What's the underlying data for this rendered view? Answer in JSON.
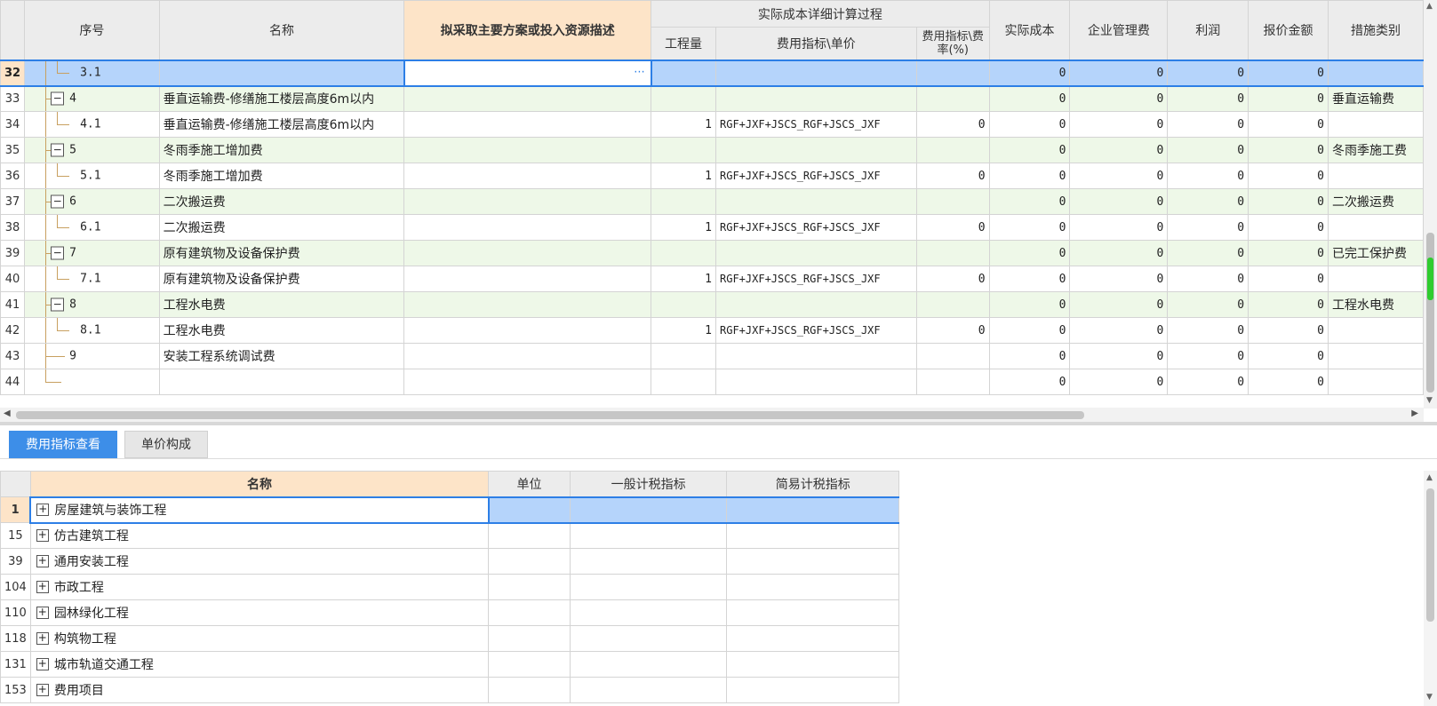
{
  "upper_grid": {
    "headers": {
      "seq": "序号",
      "name": "名称",
      "plan": "拟采取主要方案或投入资源描述",
      "detail_group": "实际成本详细计算过程",
      "qty": "工程量",
      "index_unit": "费用指标\\单价",
      "rate": "费用指标\\费率(%)",
      "actual_cost": "实际成本",
      "mgmt_fee": "企业管理费",
      "profit": "利润",
      "quote": "报价金额",
      "category": "措施类别"
    },
    "rows": [
      {
        "rn": "32",
        "seq": "3.1",
        "level": 2,
        "name": "",
        "qty": "",
        "formula": "",
        "rate": "",
        "actual": "0",
        "mgmt": "0",
        "profit": "0",
        "quote": "0",
        "cat": "",
        "selected": true
      },
      {
        "rn": "33",
        "seq": "4",
        "level": 1,
        "name": "垂直运输费-修缮施工楼层高度6m以内",
        "qty": "",
        "formula": "",
        "rate": "",
        "actual": "0",
        "mgmt": "0",
        "profit": "0",
        "quote": "0",
        "cat": "垂直运输费"
      },
      {
        "rn": "34",
        "seq": "4.1",
        "level": 2,
        "name": "垂直运输费-修缮施工楼层高度6m以内",
        "qty": "1",
        "formula": "RGF+JXF+JSCS_RGF+JSCS_JXF",
        "rate": "0",
        "actual": "0",
        "mgmt": "0",
        "profit": "0",
        "quote": "0",
        "cat": ""
      },
      {
        "rn": "35",
        "seq": "5",
        "level": 1,
        "name": "冬雨季施工增加费",
        "qty": "",
        "formula": "",
        "rate": "",
        "actual": "0",
        "mgmt": "0",
        "profit": "0",
        "quote": "0",
        "cat": "冬雨季施工费"
      },
      {
        "rn": "36",
        "seq": "5.1",
        "level": 2,
        "name": "冬雨季施工增加费",
        "qty": "1",
        "formula": "RGF+JXF+JSCS_RGF+JSCS_JXF",
        "rate": "0",
        "actual": "0",
        "mgmt": "0",
        "profit": "0",
        "quote": "0",
        "cat": ""
      },
      {
        "rn": "37",
        "seq": "6",
        "level": 1,
        "name": "二次搬运费",
        "qty": "",
        "formula": "",
        "rate": "",
        "actual": "0",
        "mgmt": "0",
        "profit": "0",
        "quote": "0",
        "cat": "二次搬运费"
      },
      {
        "rn": "38",
        "seq": "6.1",
        "level": 2,
        "name": "二次搬运费",
        "qty": "1",
        "formula": "RGF+JXF+JSCS_RGF+JSCS_JXF",
        "rate": "0",
        "actual": "0",
        "mgmt": "0",
        "profit": "0",
        "quote": "0",
        "cat": ""
      },
      {
        "rn": "39",
        "seq": "7",
        "level": 1,
        "name": "原有建筑物及设备保护费",
        "qty": "",
        "formula": "",
        "rate": "",
        "actual": "0",
        "mgmt": "0",
        "profit": "0",
        "quote": "0",
        "cat": "已完工保护费"
      },
      {
        "rn": "40",
        "seq": "7.1",
        "level": 2,
        "name": "原有建筑物及设备保护费",
        "qty": "1",
        "formula": "RGF+JXF+JSCS_RGF+JSCS_JXF",
        "rate": "0",
        "actual": "0",
        "mgmt": "0",
        "profit": "0",
        "quote": "0",
        "cat": ""
      },
      {
        "rn": "41",
        "seq": "8",
        "level": 1,
        "name": "工程水电费",
        "qty": "",
        "formula": "",
        "rate": "",
        "actual": "0",
        "mgmt": "0",
        "profit": "0",
        "quote": "0",
        "cat": "工程水电费"
      },
      {
        "rn": "42",
        "seq": "8.1",
        "level": 2,
        "name": "工程水电费",
        "qty": "1",
        "formula": "RGF+JXF+JSCS_RGF+JSCS_JXF",
        "rate": "0",
        "actual": "0",
        "mgmt": "0",
        "profit": "0",
        "quote": "0",
        "cat": ""
      },
      {
        "rn": "43",
        "seq": "9",
        "level": 0,
        "name": "安装工程系统调试费",
        "qty": "",
        "formula": "",
        "rate": "",
        "actual": "0",
        "mgmt": "0",
        "profit": "0",
        "quote": "0",
        "cat": ""
      },
      {
        "rn": "44",
        "seq": "",
        "level": 0,
        "name": "",
        "qty": "",
        "formula": "",
        "rate": "",
        "actual": "0",
        "mgmt": "0",
        "profit": "0",
        "quote": "0",
        "cat": "",
        "last": true
      }
    ]
  },
  "tabs": [
    {
      "label": "费用指标查看",
      "active": true
    },
    {
      "label": "单价构成",
      "active": false
    }
  ],
  "lower_grid": {
    "headers": {
      "name": "名称",
      "unit": "单位",
      "general": "一般计税指标",
      "simple": "简易计税指标"
    },
    "rows": [
      {
        "rn": "1",
        "name": "房屋建筑与装饰工程",
        "selected": true
      },
      {
        "rn": "15",
        "name": "仿古建筑工程"
      },
      {
        "rn": "39",
        "name": "通用安装工程"
      },
      {
        "rn": "104",
        "name": "市政工程"
      },
      {
        "rn": "110",
        "name": "园林绿化工程"
      },
      {
        "rn": "118",
        "name": "构筑物工程"
      },
      {
        "rn": "131",
        "name": "城市轨道交通工程"
      },
      {
        "rn": "153",
        "name": "费用项目"
      }
    ]
  },
  "icons": {
    "expand": "plus-box-icon",
    "collapse": "minus-box-icon",
    "ellipsis": "ellipsis-icon"
  },
  "colors": {
    "accent": "#3d8ee8",
    "selection": "#b5d4fb",
    "group_row": "#eef8e8",
    "header_highlight": "#fde4c8"
  }
}
